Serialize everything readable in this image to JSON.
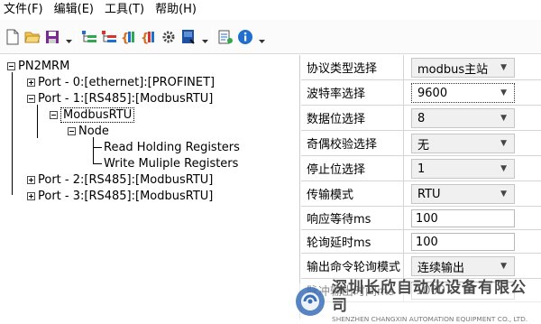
{
  "menu": {
    "file": "文件(F)",
    "edit": "编辑(E)",
    "tools": "工具(T)",
    "help": "帮助(H)"
  },
  "toolbar": {
    "icons": [
      "new-file-icon",
      "open-folder-icon",
      "save-icon",
      "add-port-icon",
      "add-node-icon",
      "read-register-icon",
      "write-register-icon",
      "settings-icon",
      "download-icon",
      "properties-icon",
      "info-icon"
    ]
  },
  "tree": {
    "root": "PN2MRM",
    "port0": "Port - 0:[ethernet]:[PROFINET]",
    "port1": "Port - 1:[RS485]:[ModbusRTU]",
    "modbus": "ModbusRTU",
    "node": "Node",
    "read": "Read Holding Registers",
    "write": "Write Muliple Registers",
    "port2": "Port - 2:[RS485]:[ModbusRTU]",
    "port3": "Port - 3:[RS485]:[ModbusRTU]"
  },
  "props": [
    {
      "label": "协议类型选择",
      "value": "modbus主站",
      "kind": "combo"
    },
    {
      "label": "波特率选择",
      "value": "9600",
      "kind": "combo",
      "focus": true
    },
    {
      "label": "数据位选择",
      "value": "8",
      "kind": "combo"
    },
    {
      "label": "奇偶校验选择",
      "value": "无",
      "kind": "combo"
    },
    {
      "label": "停止位选择",
      "value": "1",
      "kind": "combo"
    },
    {
      "label": "传输模式",
      "value": "RTU",
      "kind": "combo"
    },
    {
      "label": "响应等待ms",
      "value": "100",
      "kind": "text"
    },
    {
      "label": "轮询延时ms",
      "value": "100",
      "kind": "text"
    },
    {
      "label": "输出命令轮询模式",
      "value": "连续输出",
      "kind": "combo"
    },
    {
      "label": "脉冲输出时间ms",
      "value": "1000",
      "kind": "text"
    }
  ],
  "watermark": {
    "cn": "深圳长欣自动化设备有限公司",
    "en": "SHENZHEN CHANGXIN AUTOMATION EQUIPMENT CO., LTD."
  },
  "colors": {
    "blue": "#1f6fd0",
    "green": "#2fa84f",
    "red": "#d8342c",
    "logo": "#3b6fb6"
  }
}
